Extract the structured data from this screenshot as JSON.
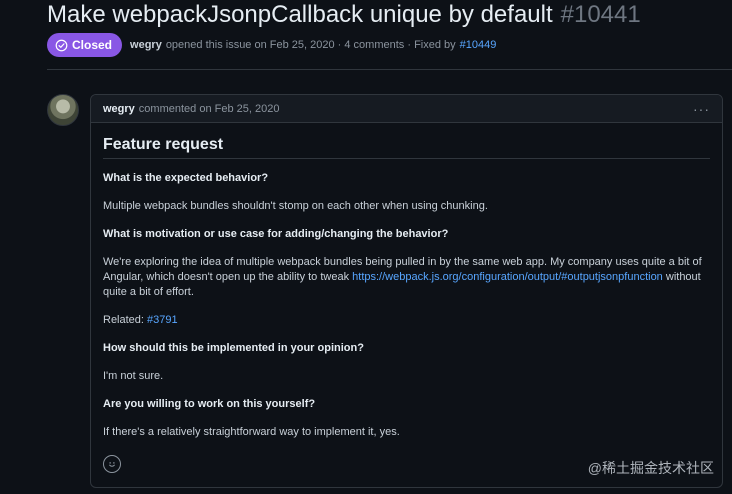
{
  "issue": {
    "title": "Make webpackJsonpCallback unique by default",
    "number": "#10441",
    "state": "Closed",
    "author": "wegry",
    "opened_text": "opened this issue on Feb 25, 2020 · 4 comments · Fixed by",
    "fixed_by": "#10449"
  },
  "comment": {
    "author": "wegry",
    "commented_text": "commented on Feb 25, 2020",
    "menu_glyph": "···",
    "heading": "Feature request",
    "q1": "What is the expected behavior?",
    "a1": "Multiple webpack bundles shouldn't stomp on each other when using chunking.",
    "q2": "What is motivation or use case for adding/changing the behavior?",
    "a2_part1": "We're exploring the idea of multiple webpack bundles being pulled in by the same web app. My company uses quite a bit of Angular, which doesn't open up the ability to tweak",
    "a2_link": "https://webpack.js.org/configuration/output/#outputjsonpfunction",
    "a2_part2": "without quite a bit of effort.",
    "related_label": "Related:",
    "related_link": "#3791",
    "q3": "How should this be implemented in your opinion?",
    "a3": "I'm not sure.",
    "q4": "Are you willing to work on this yourself?",
    "a4": "If there's a relatively straightforward way to implement it, yes."
  },
  "watermark": "@稀土掘金技术社区",
  "icons": {
    "state": "check-circle-icon",
    "reaction": "smiley-icon",
    "menu": "kebab-horizontal-icon",
    "avatar": "user-avatar"
  },
  "colors": {
    "background": "#0d1117",
    "closed_badge": "#8957e5",
    "link": "#58a6ff",
    "border": "#30363d"
  }
}
